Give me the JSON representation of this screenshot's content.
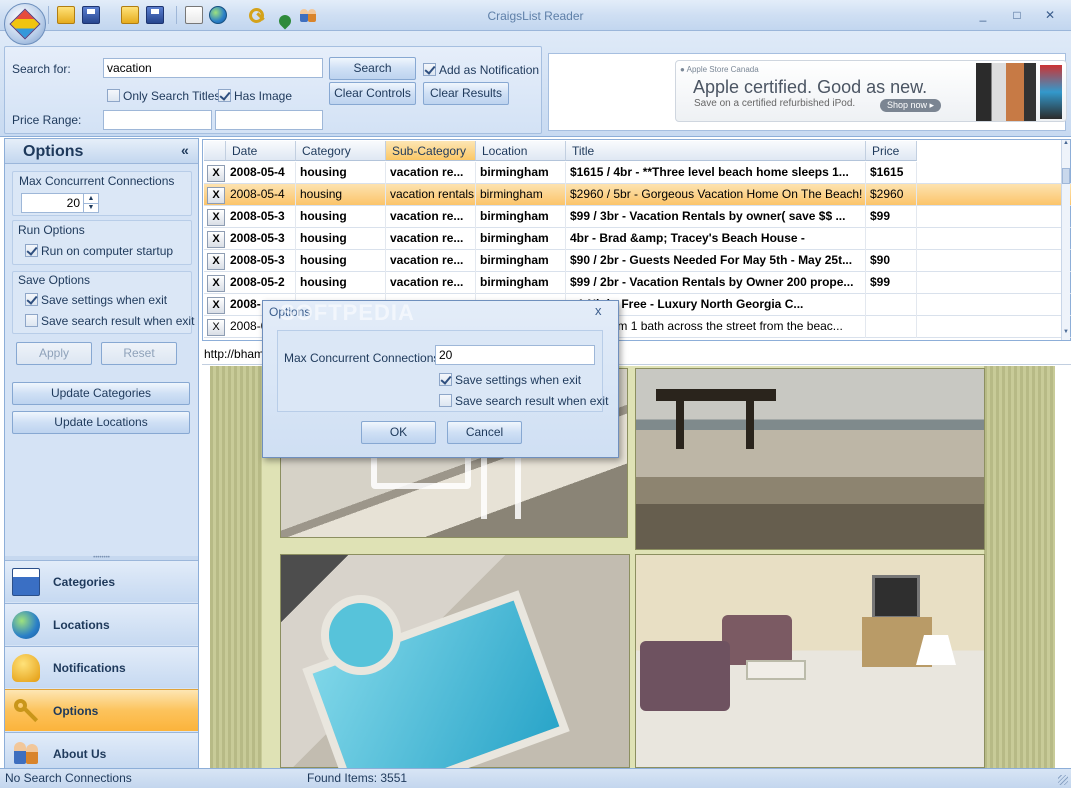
{
  "app": {
    "title": "CraigsList Reader"
  },
  "window_controls": {
    "minimize": "_",
    "maximize": "□",
    "close": "✕"
  },
  "search": {
    "search_for_label": "Search for:",
    "search_for_value": "vacation",
    "search_button": "Search",
    "add_as_notification_label": "Add as Notification",
    "add_as_notification_checked": true,
    "only_search_titles_label": "Only Search Titles",
    "only_search_titles_checked": false,
    "has_image_label": "Has Image",
    "has_image_checked": true,
    "clear_controls_button": "Clear Controls",
    "clear_results_button": "Clear Results",
    "price_range_label": "Price Range:",
    "price_min_value": "",
    "price_max_value": ""
  },
  "ad": {
    "brand": "Apple Store Canada",
    "headline": "Apple certified. Good as new.",
    "subline": "Save on a certified refurbished iPod.",
    "cta": "Shop now"
  },
  "options_panel": {
    "title": "Options",
    "collapse_glyph": "«",
    "max_connections_label": "Max Concurrent Connections",
    "max_connections_value": "20",
    "run_options_label": "Run Options",
    "run_on_startup_label": "Run on computer startup",
    "run_on_startup_checked": true,
    "save_options_label": "Save Options",
    "save_settings_label": "Save settings when exit",
    "save_settings_checked": true,
    "save_search_label": "Save search result when exit",
    "save_search_checked": false,
    "apply_button": "Apply",
    "reset_button": "Reset",
    "update_categories_button": "Update Categories",
    "update_locations_button": "Update Locations"
  },
  "nav": [
    {
      "label": "Categories",
      "icon": "calendar-clock-icon",
      "active": false
    },
    {
      "label": "Locations",
      "icon": "globe-icon",
      "active": false
    },
    {
      "label": "Notifications",
      "icon": "bell-icon",
      "active": false
    },
    {
      "label": "Options",
      "icon": "key-icon",
      "active": true
    },
    {
      "label": "About Us",
      "icon": "people-icon",
      "active": false
    }
  ],
  "grid": {
    "columns": [
      "Date",
      "Category",
      "Sub-Category",
      "Location",
      "Title",
      "Price"
    ],
    "sorted_column": "Sub-Category",
    "rows": [
      {
        "x": "X",
        "date": "2008-05-4",
        "category": "housing",
        "subcategory": "vacation re...",
        "location": "birmingham",
        "title": "$1615 / 4br - **Three level beach home sleeps 1...",
        "price": "$1615",
        "bold": true,
        "selected": false
      },
      {
        "x": "X",
        "date": "2008-05-4",
        "category": "housing",
        "subcategory": "vacation rentals",
        "location": "birmingham",
        "title": "$2960 / 5br - Gorgeous Vacation  Home On The Beach! -",
        "price": "$2960",
        "bold": false,
        "selected": true
      },
      {
        "x": "X",
        "date": "2008-05-3",
        "category": "housing",
        "subcategory": "vacation re...",
        "location": "birmingham",
        "title": "$99 / 3br - Vacation Rentals by owner( save $$  ...",
        "price": "$99",
        "bold": true,
        "selected": false
      },
      {
        "x": "X",
        "date": "2008-05-3",
        "category": "housing",
        "subcategory": "vacation re...",
        "location": "birmingham",
        "title": "4br - Brad &amp; Tracey's Beach House -",
        "price": "",
        "bold": true,
        "selected": false
      },
      {
        "x": "X",
        "date": "2008-05-3",
        "category": "housing",
        "subcategory": "vacation re...",
        "location": "birmingham",
        "title": "$90 / 2br - Guests Needed For May 5th - May 25t...",
        "price": "$90",
        "bold": true,
        "selected": false
      },
      {
        "x": "X",
        "date": "2008-05-2",
        "category": "housing",
        "subcategory": "vacation re...",
        "location": "birmingham",
        "title": "$99 / 2br - Vacation Rentals by Owner 200 prope...",
        "price": "$99",
        "bold": true,
        "selected": false
      },
      {
        "x": "X",
        "date": "2008-",
        "category": "",
        "subcategory": "",
        "location": "",
        "title": "- 1 Night Free - Luxury North Georgia C...",
        "price": "",
        "bold": true,
        "selected": false
      },
      {
        "x": "X",
        "date": "2008-0",
        "category": "",
        "subcategory": "",
        "location": "",
        "title": "1 bedroom 1 bath across the street from the beac...",
        "price": "",
        "bold": false,
        "selected": false
      }
    ]
  },
  "browser": {
    "url": "http://bham"
  },
  "dialog": {
    "title": "Options",
    "close_glyph": "x",
    "max_connections_label": "Max Concurrent Connections",
    "max_connections_value": "20",
    "save_settings_label": "Save settings when exit",
    "save_settings_checked": true,
    "save_search_label": "Save search result when exit",
    "save_search_checked": false,
    "ok_button": "OK",
    "cancel_button": "Cancel"
  },
  "watermark": "SOFTPEDIA",
  "status": {
    "left": "No Search Connections",
    "found": "Found Items: 3551"
  }
}
